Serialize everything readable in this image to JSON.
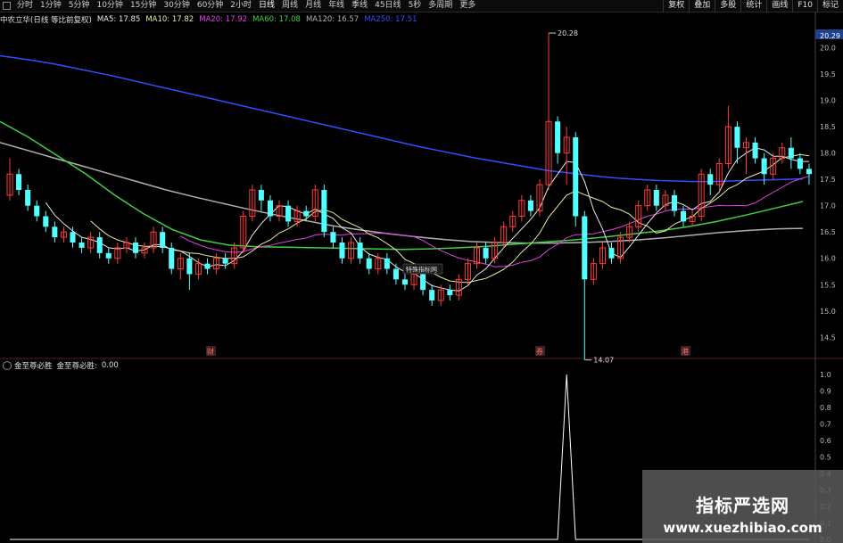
{
  "toolbar": {
    "items": [
      "分时",
      "1分钟",
      "5分钟",
      "10分钟",
      "15分钟",
      "30分钟",
      "60分钟",
      "2小时",
      "日线",
      "周线",
      "月线",
      "年线",
      "季线",
      "45日线",
      "5秒",
      "多周期",
      "更多"
    ],
    "active_index": 8,
    "right_buttons": [
      "复权",
      "叠加",
      "多股",
      "统计",
      "画线",
      "F10",
      "标记"
    ]
  },
  "info": {
    "stock": "中农立华(日线 等比前复权)",
    "ma": [
      {
        "label": "MA5: 17.85",
        "color": "#e8e8e8"
      },
      {
        "label": "MA10: 17.82",
        "color": "#e8e8a0"
      },
      {
        "label": "MA20: 17.92",
        "color": "#e040e0"
      },
      {
        "label": "MA60: 17.08",
        "color": "#40d040"
      },
      {
        "label": "MA120: 16.57",
        "color": "#b0b0b0"
      },
      {
        "label": "MA250: 17.51",
        "color": "#3050ff"
      }
    ]
  },
  "sub_info": {
    "name": "金至尊必胜",
    "label": "金至尊必胜:",
    "value": "0.00"
  },
  "watermark": {
    "title": "指标严选网",
    "url": "www.xuezhibiao.com"
  },
  "chart_data": {
    "type": "candlestick",
    "y_axis_labels": [
      "20.29",
      "20.0",
      "19.5",
      "19.0",
      "18.5",
      "18.0",
      "17.5",
      "17.0",
      "16.5",
      "16.0",
      "15.5",
      "15.0",
      "14.5"
    ],
    "annotations": [
      "20.28",
      "14.07",
      "特殊指标网"
    ],
    "event_markers": [
      "财",
      "券",
      "港"
    ],
    "sub_axis_labels": [
      "1.0",
      "0.9",
      "0.8",
      "0.7",
      "0.6",
      "0.5",
      "0.4",
      "0.3",
      "0.2",
      "0.1",
      "0.0"
    ],
    "colors": {
      "up": "#ff3b3b",
      "down": "#54ffff",
      "ma5": "#e8e8e8",
      "ma10": "#e8e8a0",
      "ma20": "#e040e0",
      "ma60": "#40d040",
      "ma120": "#b0b0b0",
      "ma250": "#3050ff",
      "signal": "#ffffff"
    },
    "candles": [
      [
        17.2,
        17.6,
        17.9,
        17.1
      ],
      [
        17.6,
        17.3,
        17.7,
        17.2
      ],
      [
        17.3,
        17.0,
        17.4,
        16.9
      ],
      [
        17.0,
        16.8,
        17.1,
        16.7
      ],
      [
        16.8,
        16.6,
        16.9,
        16.5
      ],
      [
        16.6,
        16.4,
        16.7,
        16.3
      ],
      [
        16.4,
        16.5,
        16.6,
        16.3
      ],
      [
        16.5,
        16.3,
        16.6,
        16.2
      ],
      [
        16.3,
        16.2,
        16.4,
        16.1
      ],
      [
        16.2,
        16.4,
        16.5,
        16.1
      ],
      [
        16.4,
        16.1,
        16.5,
        16.0
      ],
      [
        16.1,
        16.0,
        16.2,
        15.9
      ],
      [
        16.0,
        16.2,
        16.3,
        15.9
      ],
      [
        16.2,
        16.3,
        16.4,
        16.1
      ],
      [
        16.3,
        16.1,
        16.4,
        16.0
      ],
      [
        16.1,
        16.2,
        16.3,
        16.0
      ],
      [
        16.2,
        16.5,
        16.6,
        16.1
      ],
      [
        16.5,
        16.2,
        16.6,
        16.1
      ],
      [
        16.2,
        15.8,
        16.3,
        15.7
      ],
      [
        15.8,
        16.0,
        16.1,
        15.6
      ],
      [
        16.0,
        15.7,
        16.1,
        15.4
      ],
      [
        15.7,
        15.9,
        16.0,
        15.6
      ],
      [
        15.9,
        15.8,
        16.0,
        15.7
      ],
      [
        15.8,
        16.0,
        16.1,
        15.7
      ],
      [
        16.0,
        15.9,
        16.1,
        15.8
      ],
      [
        15.9,
        16.2,
        16.3,
        15.8
      ],
      [
        16.2,
        16.8,
        16.9,
        16.1
      ],
      [
        16.8,
        17.3,
        17.4,
        16.7
      ],
      [
        17.3,
        17.1,
        17.4,
        16.9
      ],
      [
        17.1,
        16.8,
        17.2,
        16.7
      ],
      [
        16.8,
        17.0,
        17.1,
        16.7
      ],
      [
        17.0,
        16.7,
        17.1,
        16.6
      ],
      [
        16.7,
        16.9,
        17.0,
        16.6
      ],
      [
        16.9,
        16.8,
        17.0,
        16.7
      ],
      [
        16.8,
        17.3,
        17.4,
        16.7
      ],
      [
        17.3,
        16.5,
        17.4,
        16.4
      ],
      [
        16.5,
        16.3,
        16.6,
        16.2
      ],
      [
        16.3,
        16.0,
        16.4,
        15.9
      ],
      [
        16.0,
        16.3,
        16.4,
        15.9
      ],
      [
        16.3,
        16.0,
        16.4,
        15.9
      ],
      [
        16.0,
        15.8,
        16.1,
        15.7
      ],
      [
        15.8,
        16.0,
        16.1,
        15.7
      ],
      [
        16.0,
        15.8,
        16.1,
        15.7
      ],
      [
        15.8,
        15.6,
        15.9,
        15.5
      ],
      [
        15.6,
        15.5,
        15.7,
        15.4
      ],
      [
        15.5,
        15.7,
        15.8,
        15.4
      ],
      [
        15.7,
        15.4,
        15.8,
        15.3
      ],
      [
        15.4,
        15.2,
        15.5,
        15.1
      ],
      [
        15.2,
        15.4,
        15.5,
        15.1
      ],
      [
        15.4,
        15.3,
        15.5,
        15.2
      ],
      [
        15.3,
        15.6,
        15.7,
        15.2
      ],
      [
        15.6,
        15.9,
        16.0,
        15.5
      ],
      [
        15.9,
        16.2,
        16.3,
        15.8
      ],
      [
        16.2,
        16.0,
        16.3,
        15.9
      ],
      [
        16.0,
        16.3,
        16.4,
        15.9
      ],
      [
        16.3,
        16.6,
        16.7,
        16.2
      ],
      [
        16.6,
        16.8,
        16.9,
        16.5
      ],
      [
        16.8,
        17.1,
        17.2,
        16.7
      ],
      [
        17.1,
        16.9,
        17.2,
        16.8
      ],
      [
        16.9,
        17.4,
        17.5,
        16.8
      ],
      [
        17.4,
        18.6,
        20.28,
        17.3
      ],
      [
        18.6,
        18.0,
        18.7,
        17.8
      ],
      [
        18.0,
        18.3,
        18.5,
        17.4
      ],
      [
        18.3,
        16.8,
        18.4,
        16.6
      ],
      [
        16.8,
        15.6,
        16.9,
        14.07
      ],
      [
        15.6,
        15.9,
        16.0,
        15.5
      ],
      [
        15.9,
        16.2,
        16.3,
        15.8
      ],
      [
        16.2,
        16.0,
        16.3,
        15.9
      ],
      [
        16.0,
        16.4,
        16.5,
        15.9
      ],
      [
        16.4,
        16.6,
        16.7,
        16.3
      ],
      [
        16.6,
        17.0,
        17.1,
        16.5
      ],
      [
        17.0,
        17.3,
        17.4,
        16.9
      ],
      [
        17.3,
        17.0,
        17.4,
        16.9
      ],
      [
        17.0,
        17.2,
        17.3,
        16.9
      ],
      [
        17.2,
        16.9,
        17.3,
        16.8
      ],
      [
        16.9,
        16.7,
        17.0,
        16.6
      ],
      [
        16.7,
        16.8,
        16.9,
        16.6
      ],
      [
        16.8,
        17.6,
        17.7,
        16.7
      ],
      [
        17.6,
        17.4,
        17.7,
        17.2
      ],
      [
        17.4,
        17.8,
        17.9,
        17.3
      ],
      [
        17.8,
        18.5,
        18.9,
        17.7
      ],
      [
        18.5,
        18.1,
        18.6,
        17.8
      ],
      [
        18.1,
        18.2,
        18.3,
        17.6
      ],
      [
        18.2,
        17.9,
        18.3,
        17.8
      ],
      [
        17.9,
        17.6,
        18.0,
        17.4
      ],
      [
        17.6,
        17.9,
        18.0,
        17.5
      ],
      [
        17.9,
        18.1,
        18.2,
        17.8
      ],
      [
        18.1,
        17.9,
        18.3,
        17.7
      ],
      [
        17.9,
        17.7,
        18.0,
        17.6
      ],
      [
        17.7,
        17.6,
        17.8,
        17.4
      ]
    ],
    "ma250": [
      19.85,
      19.8,
      19.75,
      19.69,
      19.62,
      19.55,
      19.48,
      19.4,
      19.32,
      19.24,
      19.16,
      19.08,
      19.0,
      18.92,
      18.84,
      18.76,
      18.68,
      18.6,
      18.52,
      18.44,
      18.36,
      18.28,
      18.2,
      18.12,
      18.05,
      17.98,
      17.91,
      17.85,
      17.79,
      17.73,
      17.67,
      17.63,
      17.59,
      17.55,
      17.52,
      17.5,
      17.48,
      17.47,
      17.46,
      17.46,
      17.47,
      17.48,
      17.49,
      17.5,
      17.51
    ],
    "ma120": [
      18.2,
      18.05,
      17.9,
      17.75,
      17.6,
      17.45,
      17.3,
      17.17,
      17.05,
      16.93,
      16.82,
      16.72,
      16.62,
      16.54,
      16.47,
      16.41,
      16.36,
      16.32,
      16.3,
      16.29,
      16.29,
      16.3,
      16.32,
      16.35,
      16.39,
      16.44,
      16.49,
      16.53,
      16.56,
      16.57
    ],
    "ma60": [
      18.6,
      18.3,
      17.95,
      17.6,
      17.2,
      16.85,
      16.55,
      16.35,
      16.25,
      16.22,
      16.21,
      16.2,
      16.19,
      16.18,
      16.17,
      16.18,
      16.2,
      16.23,
      16.27,
      16.31,
      16.35,
      16.4,
      16.46,
      16.52,
      16.6,
      16.7,
      16.82,
      16.95,
      17.08
    ],
    "signal": [
      0,
      0,
      0,
      0,
      0,
      0,
      0,
      0,
      0,
      0,
      0,
      0,
      0,
      0,
      0,
      0,
      0,
      0,
      0,
      0,
      0,
      0,
      0,
      0,
      0,
      0,
      0,
      0,
      0,
      0,
      0,
      0,
      0,
      0,
      0,
      0,
      0,
      0,
      0,
      0,
      0,
      0,
      0,
      0,
      0,
      0,
      0,
      0,
      0,
      0,
      0,
      0,
      0,
      0,
      0,
      0,
      0,
      0,
      0,
      0,
      0,
      0,
      1,
      0,
      0,
      0,
      0,
      0,
      0,
      0,
      0,
      0,
      0,
      0,
      0,
      0,
      0,
      0,
      0,
      0,
      0,
      0,
      0,
      0,
      0,
      0,
      0,
      0,
      0,
      0
    ],
    "sub_ylim": [
      0,
      1
    ]
  }
}
